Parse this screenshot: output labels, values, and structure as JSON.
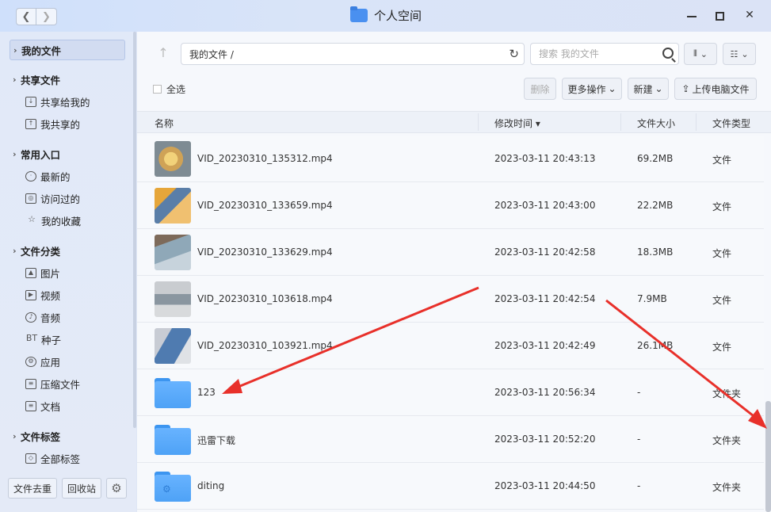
{
  "window": {
    "title": "个人空间",
    "back_label": "❮",
    "forward_label": "❯",
    "minimize_label": "",
    "close_label": "✕"
  },
  "sidebar": {
    "my_files": "我的文件",
    "shared": {
      "label": "共享文件",
      "items": [
        {
          "label": "共享给我的",
          "icon": "share-in-icon"
        },
        {
          "label": "我共享的",
          "icon": "share-out-icon"
        }
      ]
    },
    "common": {
      "label": "常用入口",
      "items": [
        {
          "label": "最新的",
          "icon": "clock-icon"
        },
        {
          "label": "访问过的",
          "icon": "history-icon"
        },
        {
          "label": "我的收藏",
          "icon": "star-icon"
        }
      ]
    },
    "categories": {
      "label": "文件分类",
      "items": [
        {
          "label": "图片",
          "icon": "image-icon"
        },
        {
          "label": "视频",
          "icon": "video-icon"
        },
        {
          "label": "音频",
          "icon": "music-icon"
        },
        {
          "label": "种子",
          "icon": "bt-icon",
          "glyph": "BT"
        },
        {
          "label": "应用",
          "icon": "app-icon"
        },
        {
          "label": "压缩文件",
          "icon": "archive-icon"
        },
        {
          "label": "文档",
          "icon": "document-icon"
        }
      ]
    },
    "tags": {
      "label": "文件标签",
      "items": [
        {
          "label": "全部标签",
          "icon": "tag-icon"
        }
      ]
    },
    "bottom": {
      "dedupe": "文件去重",
      "recycle": "回收站"
    }
  },
  "toolbar": {
    "path": "我的文件 /",
    "search_placeholder": "搜索 我的文件",
    "select_all": "全选",
    "delete": "删除",
    "more_actions": "更多操作",
    "new": "新建",
    "upload": "上传电脑文件"
  },
  "table": {
    "headers": {
      "name": "名称",
      "modified": "修改时间",
      "size": "文件大小",
      "type": "文件类型"
    },
    "rows": [
      {
        "name": "VID_20230310_135312.mp4",
        "modified": "2023-03-11 20:43:13",
        "size": "69.2MB",
        "type": "文件",
        "kind": "video"
      },
      {
        "name": "VID_20230310_133659.mp4",
        "modified": "2023-03-11 20:43:00",
        "size": "22.2MB",
        "type": "文件",
        "kind": "video"
      },
      {
        "name": "VID_20230310_133629.mp4",
        "modified": "2023-03-11 20:42:58",
        "size": "18.3MB",
        "type": "文件",
        "kind": "video"
      },
      {
        "name": "VID_20230310_103618.mp4",
        "modified": "2023-03-11 20:42:54",
        "size": "7.9MB",
        "type": "文件",
        "kind": "video"
      },
      {
        "name": "VID_20230310_103921.mp4",
        "modified": "2023-03-11 20:42:49",
        "size": "26.1MB",
        "type": "文件",
        "kind": "video"
      },
      {
        "name": "123",
        "modified": "2023-03-11 20:56:34",
        "size": "-",
        "type": "文件夹",
        "kind": "folder"
      },
      {
        "name": "迅雷下载",
        "modified": "2023-03-11 20:52:20",
        "size": "-",
        "type": "文件夹",
        "kind": "folder"
      },
      {
        "name": "diting",
        "modified": "2023-03-11 20:44:50",
        "size": "-",
        "type": "文件夹",
        "kind": "folder-gear"
      }
    ]
  },
  "colors": {
    "accent": "#4a90f0",
    "annotation_arrow": "#e8302a"
  }
}
